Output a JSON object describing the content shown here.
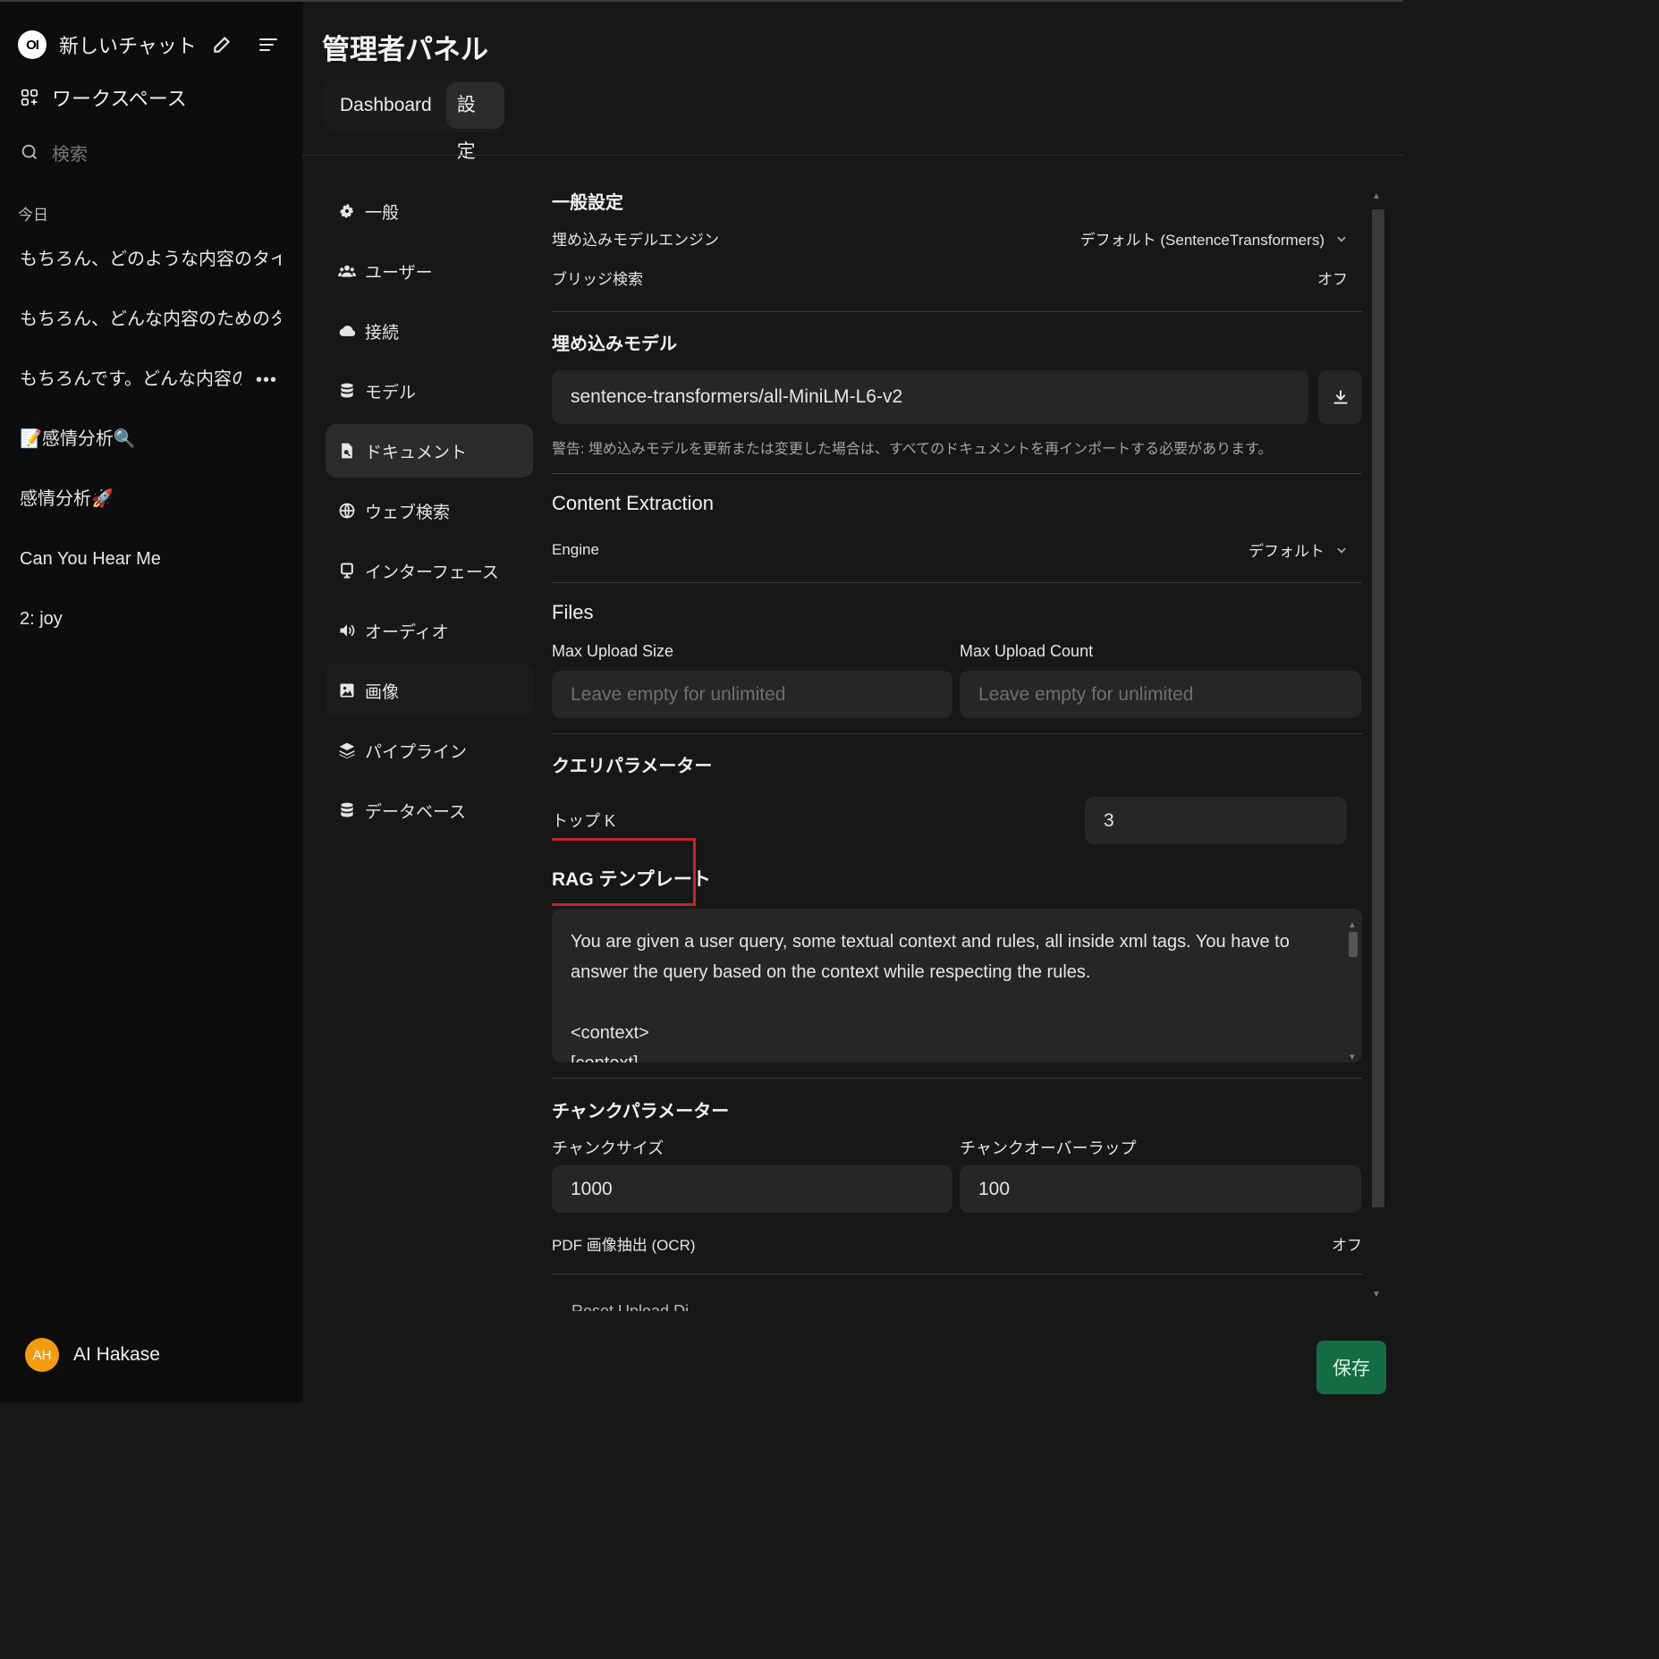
{
  "sidebar": {
    "logo_text": "OI",
    "new_chat_label": "新しいチャット",
    "workspace_label": "ワークスペース",
    "search_placeholder": "検索",
    "section_today": "今日",
    "chats": [
      "もちろん、どのような内容のタイトルを作成",
      "もちろん、どんな内容のためのタイトルを作",
      "もちろんです。どんな内容のタイト",
      "📝感情分析🔍",
      "感情分析🚀",
      "Can You Hear Me",
      "2: joy"
    ],
    "chat_more": "•••",
    "user": {
      "initials": "AH",
      "name": "AI Hakase"
    }
  },
  "header": {
    "title": "管理者パネル",
    "tabs": [
      "Dashboard",
      "設定"
    ]
  },
  "nav": {
    "items": [
      {
        "label": "一般",
        "icon": "gear-icon"
      },
      {
        "label": "ユーザー",
        "icon": "users-icon"
      },
      {
        "label": "接続",
        "icon": "cloud-icon"
      },
      {
        "label": "モデル",
        "icon": "database-icon"
      },
      {
        "label": "ドキュメント",
        "icon": "document-icon"
      },
      {
        "label": "ウェブ検索",
        "icon": "globe-icon"
      },
      {
        "label": "インターフェース",
        "icon": "monitor-icon"
      },
      {
        "label": "オーディオ",
        "icon": "speaker-icon"
      },
      {
        "label": "画像",
        "icon": "image-icon"
      },
      {
        "label": "パイプライン",
        "icon": "layers-icon"
      },
      {
        "label": "データベース",
        "icon": "database-icon"
      }
    ],
    "active": "ドキュメント"
  },
  "general": {
    "title": "一般設定",
    "embedding_engine_label": "埋め込みモデルエンジン",
    "embedding_engine_value": "デフォルト (SentenceTransformers)",
    "hybrid_search_label": "ブリッジ検索",
    "hybrid_search_value": "オフ"
  },
  "embedding_model": {
    "title": "埋め込みモデル",
    "value": "sentence-transformers/all-MiniLM-L6-v2",
    "warning": "警告: 埋め込みモデルを更新または変更した場合は、すべてのドキュメントを再インポートする必要があります。"
  },
  "content_extraction": {
    "title": "Content Extraction",
    "engine_label": "Engine",
    "engine_value": "デフォルト"
  },
  "files": {
    "title": "Files",
    "max_upload_size_label": "Max Upload Size",
    "max_upload_size_placeholder": "Leave empty for unlimited",
    "max_upload_count_label": "Max Upload Count",
    "max_upload_count_placeholder": "Leave empty for unlimited"
  },
  "query": {
    "title": "クエリパラメーター",
    "top_k_label": "トップ K",
    "top_k_value": "3"
  },
  "rag": {
    "title": "RAG テンプレート",
    "template_line1": "You are given a user query, some textual context and rules, all inside xml tags. You have to answer the query based on the context while respecting the rules.",
    "template_line2": "<context>",
    "template_line3": "[context]"
  },
  "chunk": {
    "title": "チャンクパラメーター",
    "size_label": "チャンクサイズ",
    "size_value": "1000",
    "overlap_label": "チャンクオーバーラップ",
    "overlap_value": "100",
    "pdf_ocr_label": "PDF 画像抽出 (OCR)",
    "pdf_ocr_value": "オフ"
  },
  "cut_off_text": "Reset Upload Di...",
  "save_label": "保存"
}
